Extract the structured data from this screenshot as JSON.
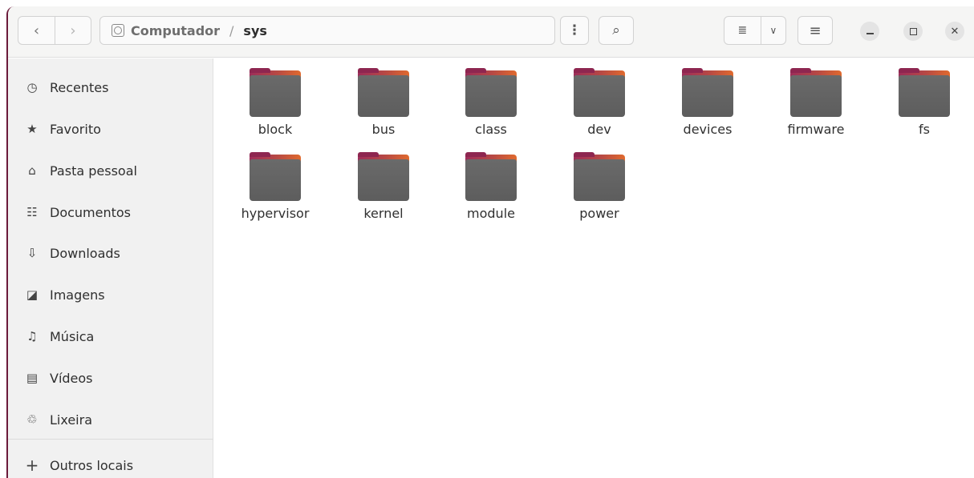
{
  "header": {
    "back_glyph": "‹",
    "forward_glyph": "›",
    "path": {
      "parent": "Computador",
      "separator": "/",
      "current": "sys"
    },
    "menu_glyph": "⋮",
    "search_glyph": "⌕",
    "view_list_glyph": "≣",
    "view_dropdown_glyph": "∨",
    "hamburger_glyph": "≡",
    "close_glyph": "✕"
  },
  "sidebar": {
    "items": [
      {
        "label": "Recentes",
        "icon": "clock-icon",
        "glyph": "◷"
      },
      {
        "label": "Favorito",
        "icon": "star-icon",
        "glyph": "★"
      },
      {
        "label": "Pasta pessoal",
        "icon": "home-icon",
        "glyph": "⌂"
      },
      {
        "label": "Documentos",
        "icon": "document-icon",
        "glyph": "☷"
      },
      {
        "label": "Downloads",
        "icon": "download-icon",
        "glyph": "⇩"
      },
      {
        "label": "Imagens",
        "icon": "image-icon",
        "glyph": "◪"
      },
      {
        "label": "Música",
        "icon": "music-icon",
        "glyph": "♫"
      },
      {
        "label": "Vídeos",
        "icon": "video-icon",
        "glyph": "▤"
      },
      {
        "label": "Lixeira",
        "icon": "trash-icon",
        "glyph": "♲"
      }
    ],
    "other": {
      "label": "Outros locais",
      "icon": "plus-icon",
      "glyph": "+"
    }
  },
  "folders": [
    "block",
    "bus",
    "class",
    "dev",
    "devices",
    "firmware",
    "fs",
    "hypervisor",
    "kernel",
    "module",
    "power"
  ],
  "colors": {
    "accent": "#e95420",
    "folder_tab_start": "#9c2d5a",
    "folder_body": "#5f5f5f"
  }
}
